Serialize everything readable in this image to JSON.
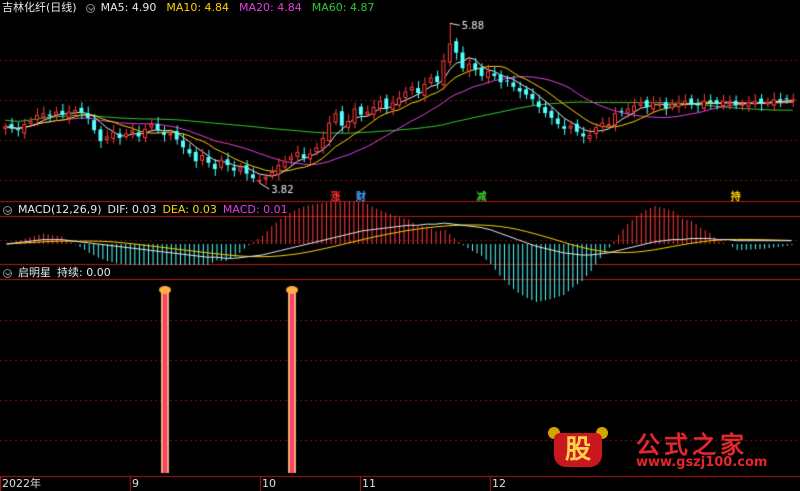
{
  "main_panel": {
    "title": "吉林化纤(日线)",
    "ma": [
      {
        "label": "MA5:",
        "value": "4.90",
        "color": "#e8e8e8"
      },
      {
        "label": "MA10:",
        "value": "4.84",
        "color": "#ffd200"
      },
      {
        "label": "MA20:",
        "value": "4.84",
        "color": "#e040e0"
      },
      {
        "label": "MA60:",
        "value": "4.87",
        "color": "#32c832"
      }
    ],
    "high_label": "5.88",
    "low_label": "3.82",
    "events": [
      {
        "text": "涨",
        "color": "#ff3030",
        "index": 52
      },
      {
        "text": "财",
        "color": "#4aa0ff",
        "index": 56
      },
      {
        "text": "减",
        "color": "#32c832",
        "index": 75
      },
      {
        "text": "持",
        "color": "#ffd200",
        "index": 115
      }
    ]
  },
  "macd_panel": {
    "name": "MACD(12,26,9)",
    "dif_label": "DIF:",
    "dif_value": "0.03",
    "dea_label": "DEA:",
    "dea_value": "0.03",
    "macd_label": "MACD:",
    "macd_value": "0.01",
    "macd_color": "#e040e0"
  },
  "indicator_panel": {
    "name": "启明星",
    "persist_label": "持续:",
    "persist_value": "0.00",
    "signals": [
      {
        "index": 25
      },
      {
        "index": 45
      }
    ]
  },
  "x_axis": {
    "labels": [
      {
        "text": "2022年",
        "index": 0
      },
      {
        "text": "9",
        "index": 21
      },
      {
        "text": "10",
        "index": 42
      },
      {
        "text": "11",
        "index": 58
      },
      {
        "text": "12",
        "index": 79
      }
    ]
  },
  "watermark": {
    "logo_char": "股",
    "title": "公式之家",
    "url": "www.gszj100.com"
  },
  "colors": {
    "up": "#ff3b3b",
    "down": "#54ffff",
    "background": "#000000",
    "grid": "#7a1010",
    "ma5": "#e8e8e8",
    "ma10": "#ffd200",
    "ma20": "#e040e0",
    "ma60": "#32c832",
    "dif": "#e8e8e8",
    "dea": "#ffd200",
    "signal": "#ff3c5a"
  },
  "chart_data": {
    "type": "candlestick",
    "title": "吉林化纤(日线)",
    "ylim": [
      3.6,
      6.0
    ],
    "high": 5.88,
    "low": 3.82,
    "closes": [
      4.55,
      4.52,
      4.5,
      4.58,
      4.62,
      4.7,
      4.72,
      4.68,
      4.74,
      4.7,
      4.74,
      4.76,
      4.72,
      4.66,
      4.5,
      4.36,
      4.42,
      4.48,
      4.4,
      4.46,
      4.5,
      4.42,
      4.52,
      4.58,
      4.5,
      4.44,
      4.46,
      4.38,
      4.28,
      4.2,
      4.1,
      4.18,
      4.08,
      4.0,
      4.12,
      4.05,
      3.98,
      4.02,
      3.94,
      3.88,
      3.86,
      3.9,
      3.96,
      4.05,
      4.1,
      4.16,
      4.22,
      4.14,
      4.2,
      4.28,
      4.4,
      4.6,
      4.72,
      4.56,
      4.62,
      4.78,
      4.7,
      4.74,
      4.8,
      4.88,
      4.78,
      4.86,
      4.92,
      5.0,
      5.06,
      4.98,
      5.1,
      5.18,
      5.12,
      5.4,
      5.62,
      5.5,
      5.3,
      5.36,
      5.28,
      5.2,
      5.26,
      5.2,
      5.12,
      5.14,
      5.06,
      5.0,
      4.96,
      4.9,
      4.8,
      4.72,
      4.66,
      4.58,
      4.52,
      4.56,
      4.48,
      4.42,
      4.44,
      4.54,
      4.6,
      4.58,
      4.72,
      4.74,
      4.78,
      4.82,
      4.86,
      4.8,
      4.86,
      4.84,
      4.78,
      4.84,
      4.86,
      4.88,
      4.84,
      4.82,
      4.88,
      4.86,
      4.84,
      4.88,
      4.86,
      4.82,
      4.84,
      4.86,
      4.88,
      4.84,
      4.86,
      4.9,
      4.88,
      4.9,
      4.9
    ],
    "macd": {
      "dif": [
        0.0,
        0.01,
        0.02,
        0.03,
        0.04,
        0.04,
        0.04,
        0.03,
        0.02,
        0.01,
        0.0,
        -0.01,
        -0.02,
        -0.03,
        -0.04,
        -0.05,
        -0.06,
        -0.07,
        -0.08,
        -0.09,
        -0.1,
        -0.11,
        -0.12,
        -0.12,
        -0.13,
        -0.13,
        -0.12,
        -0.11,
        -0.1,
        -0.08,
        -0.06,
        -0.04,
        -0.02,
        0.0,
        0.02,
        0.04,
        0.06,
        0.08,
        0.1,
        0.12,
        0.13,
        0.14,
        0.15,
        0.16,
        0.17,
        0.17,
        0.18,
        0.18,
        0.19,
        0.18,
        0.17,
        0.16,
        0.15,
        0.13,
        0.1,
        0.07,
        0.04,
        0.01,
        -0.02,
        -0.04,
        -0.06,
        -0.08,
        -0.09,
        -0.1,
        -0.1,
        -0.09,
        -0.08,
        -0.06,
        -0.04,
        -0.02,
        0.0,
        0.02,
        0.03,
        0.04,
        0.04,
        0.05,
        0.05,
        0.05,
        0.04,
        0.04,
        0.03,
        0.03,
        0.03,
        0.03,
        0.03,
        0.03,
        0.03
      ]
    },
    "signals": [
      25,
      45
    ]
  }
}
